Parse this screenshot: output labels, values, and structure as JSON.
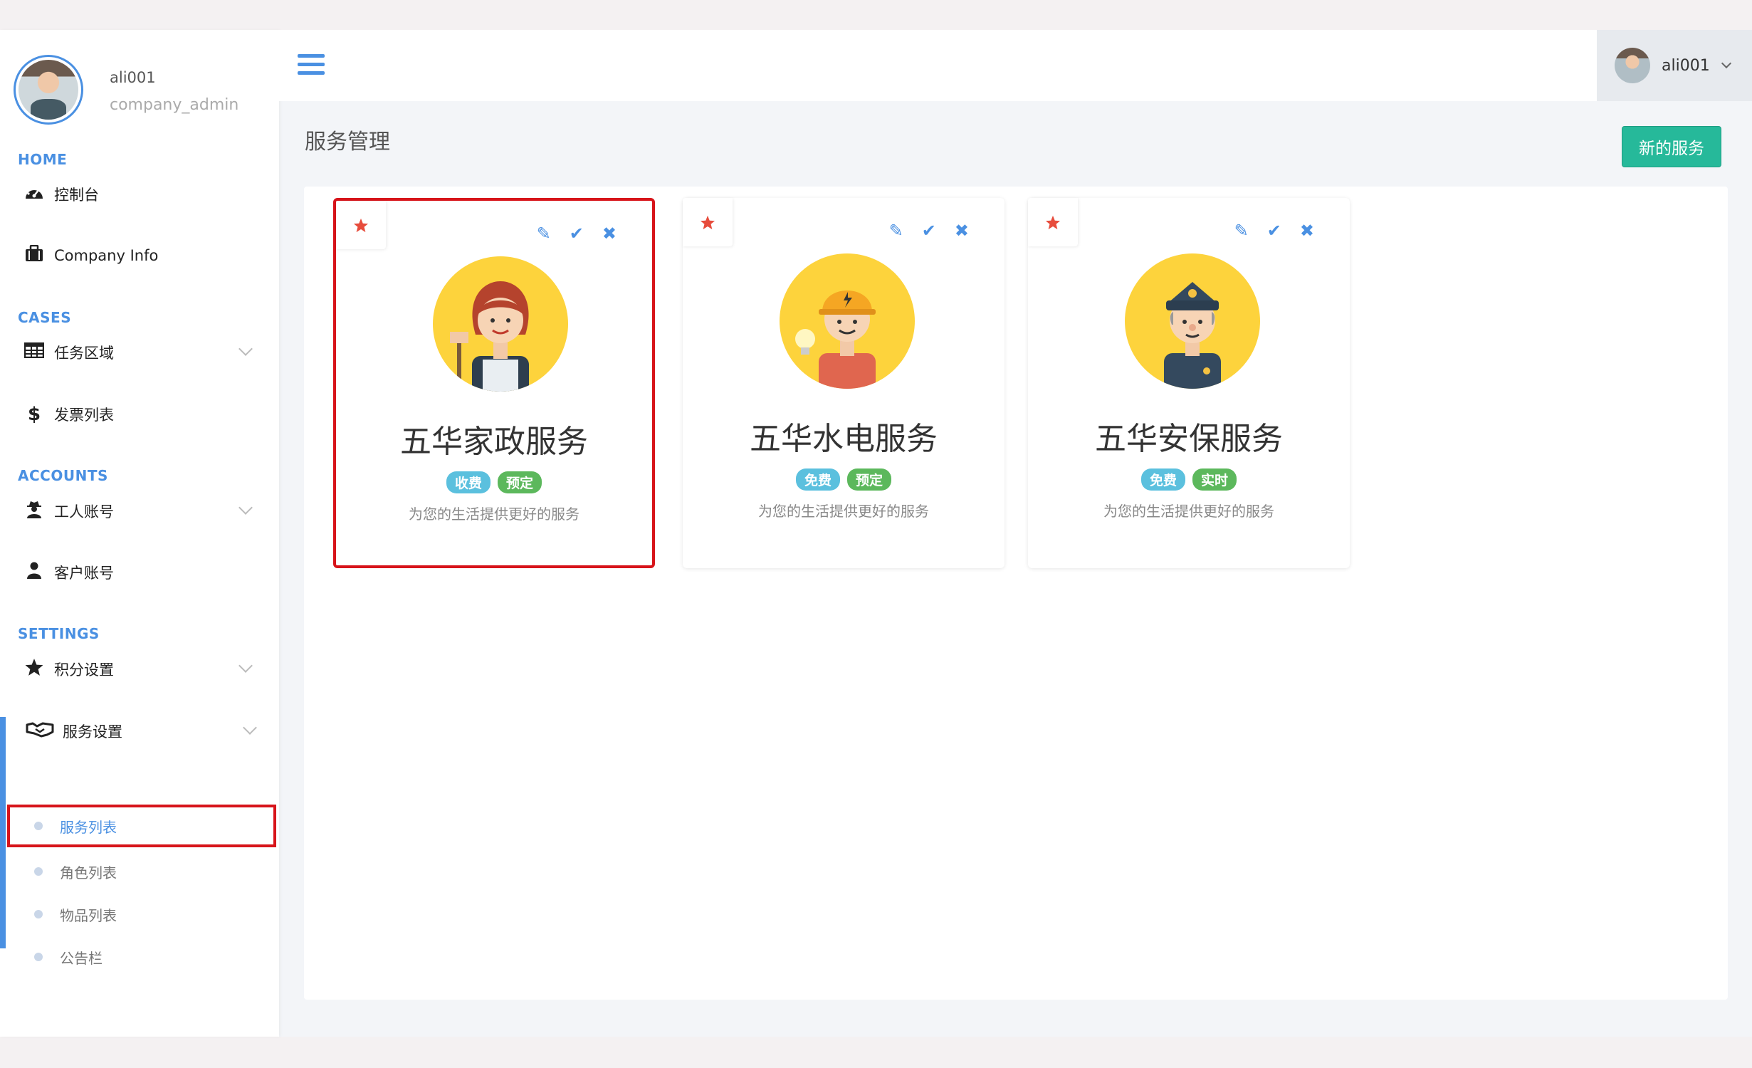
{
  "profile": {
    "username": "ali001",
    "role": "company_admin"
  },
  "sections": {
    "home": "HOME",
    "cases": "CASES",
    "accounts": "ACCOUNTS",
    "settings": "SETTINGS"
  },
  "nav": {
    "dashboard": "控制台",
    "company_info": "Company Info",
    "task_area": "任务区域",
    "invoice_list": "发票列表",
    "worker_account": "工人账号",
    "customer_account": "客户账号",
    "points_settings": "积分设置",
    "service_settings": "服务设置",
    "sub": [
      "服务列表",
      "角色列表",
      "物品列表",
      "公告栏"
    ]
  },
  "topbar": {
    "username": "ali001"
  },
  "page": {
    "title": "服务管理",
    "new_button": "新的服务"
  },
  "cards": [
    {
      "title": "五华家政服务",
      "tags": [
        "收费",
        "预定"
      ],
      "desc": "为您的生活提供更好的服务",
      "avatar": "housekeeper-avatar"
    },
    {
      "title": "五华水电服务",
      "tags": [
        "免费",
        "预定"
      ],
      "desc": "为您的生活提供更好的服务",
      "avatar": "electrician-avatar"
    },
    {
      "title": "五华安保服务",
      "tags": [
        "免费",
        "实时"
      ],
      "desc": "为您的生活提供更好的服务",
      "avatar": "security-guard-avatar"
    }
  ],
  "colors": {
    "accent": "#4a90e2",
    "success": "#26b99a",
    "tag_blue": "#5bc0de",
    "tag_green": "#5cb85c",
    "highlight": "#d7141a",
    "star": "#e74c3c"
  }
}
